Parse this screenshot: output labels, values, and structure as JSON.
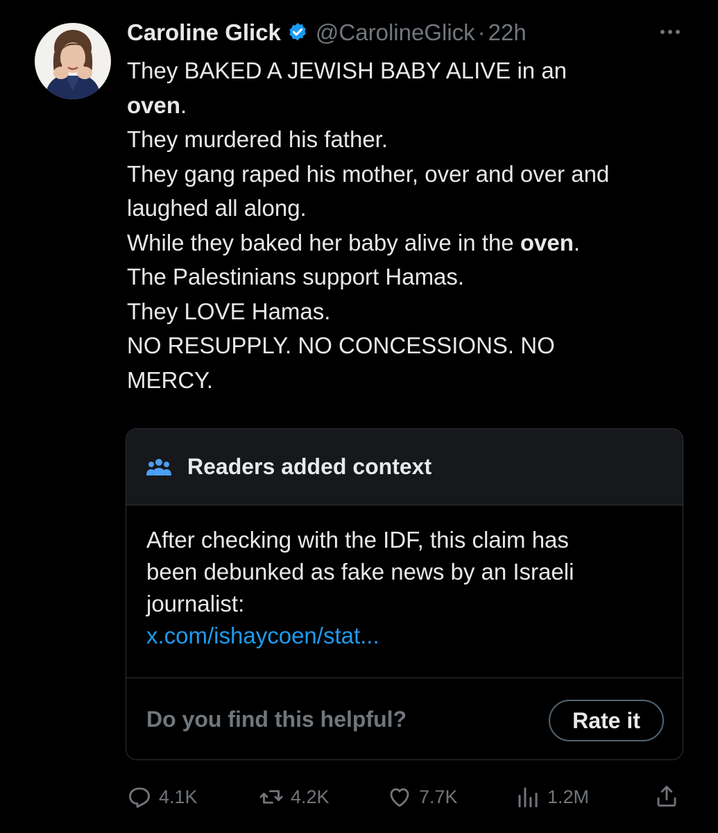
{
  "tweet": {
    "author": {
      "display_name": "Caroline Glick",
      "handle": "@CarolineGlick",
      "verified": true
    },
    "separator": "·",
    "time": "22h",
    "lines": [
      [
        "They BAKED A JEWISH BABY ALIVE in an"
      ],
      [
        {
          "b": "oven"
        },
        "."
      ],
      [
        "They murdered his father."
      ],
      [
        "They gang raped his mother, over and over and"
      ],
      [
        "laughed all along."
      ],
      [
        "While they baked her baby alive in the ",
        {
          "b": "oven"
        },
        "."
      ],
      [
        "The Palestinians support Hamas."
      ],
      [
        "They LOVE Hamas."
      ],
      [
        "NO RESUPPLY. NO CONCESSIONS. NO"
      ],
      [
        "MERCY."
      ]
    ]
  },
  "community_note": {
    "title": "Readers added context",
    "body_lines": [
      "After checking with the IDF, this claim has",
      "been debunked as fake news by an Israeli",
      "journalist:"
    ],
    "link_text": "x.com/ishaycoen/stat...",
    "helpful_prompt": "Do you find this helpful?",
    "rate_label": "Rate it"
  },
  "actions": {
    "replies": "4.1K",
    "reposts": "4.2K",
    "likes": "7.7K",
    "views": "1.2M"
  },
  "colors": {
    "background": "#000000",
    "text": "#e7e9ea",
    "muted": "#71767b",
    "link": "#1d9bf0",
    "verified": "#1d9bf0",
    "border": "#2f3336",
    "note_header_bg": "#16181c"
  },
  "icons": {
    "verified": "verified-badge-icon",
    "more": "more-horizontal-icon",
    "note": "people-icon",
    "reply": "reply-icon",
    "repost": "repost-icon",
    "like": "heart-icon",
    "views": "views-chart-icon",
    "share": "share-icon"
  }
}
